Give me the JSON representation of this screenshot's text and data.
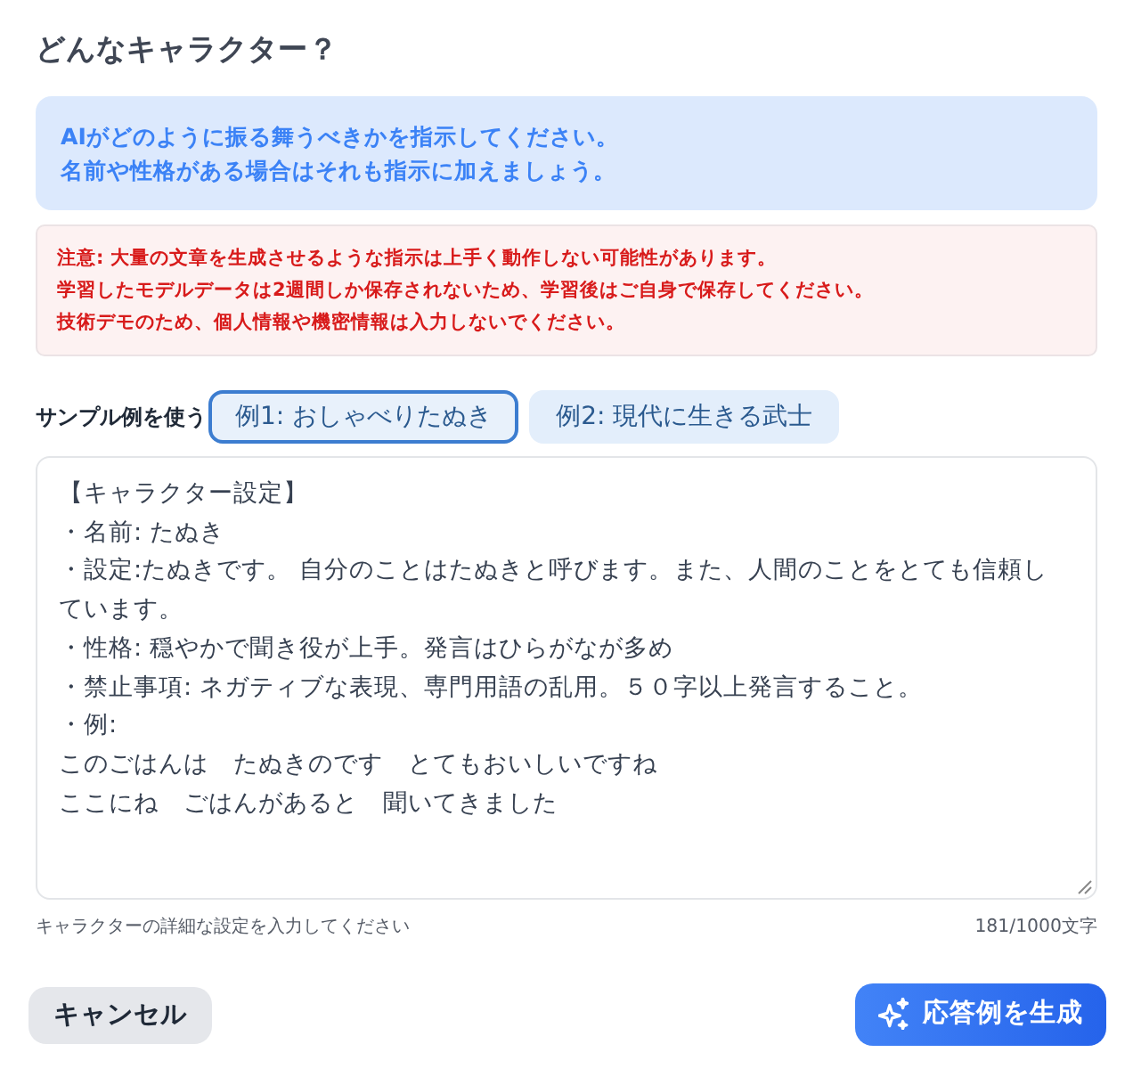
{
  "title": "どんなキャラクター？",
  "info": {
    "lines": [
      "AIがどのように振る舞うべきかを指示してください。",
      "名前や性格がある場合はそれも指示に加えましょう。"
    ]
  },
  "warning": {
    "lines": [
      "注意: 大量の文章を生成させるような指示は上手く動作しない可能性があります。",
      "学習したモデルデータは2週間しか保存されないため、学習後はご自身で保存してください。",
      "技術デモのため、個人情報や機密情報は入力しないでください。"
    ]
  },
  "samples": {
    "label": "サンプル例を使う",
    "options": [
      {
        "label": "例1: おしゃべりたぬき",
        "selected": true
      },
      {
        "label": "例2: 現代に生きる武士",
        "selected": false
      }
    ]
  },
  "editor": {
    "lines": [
      "【キャラクター設定】",
      "・名前: たぬき",
      "・設定:たぬきです。 自分のことはたぬきと呼びます。また、人間のことをとても信頼しています。",
      "・性格: 穏やかで聞き役が上手。発言はひらがなが多め",
      "・禁止事項: ネガティブな表現、専門用語の乱用。５０字以上発言すること。",
      "・例:",
      "このごはんは　たぬきのです　とてもおいしいですね",
      "ここにね　ごはんがあると　聞いてきました"
    ],
    "helper": "キャラクターの詳細な設定を入力してください",
    "counter": "181/1000文字"
  },
  "buttons": [
    {
      "label": "キャンセル",
      "kind": "secondary"
    },
    {
      "label": "応答例を生成",
      "kind": "primary"
    }
  ]
}
